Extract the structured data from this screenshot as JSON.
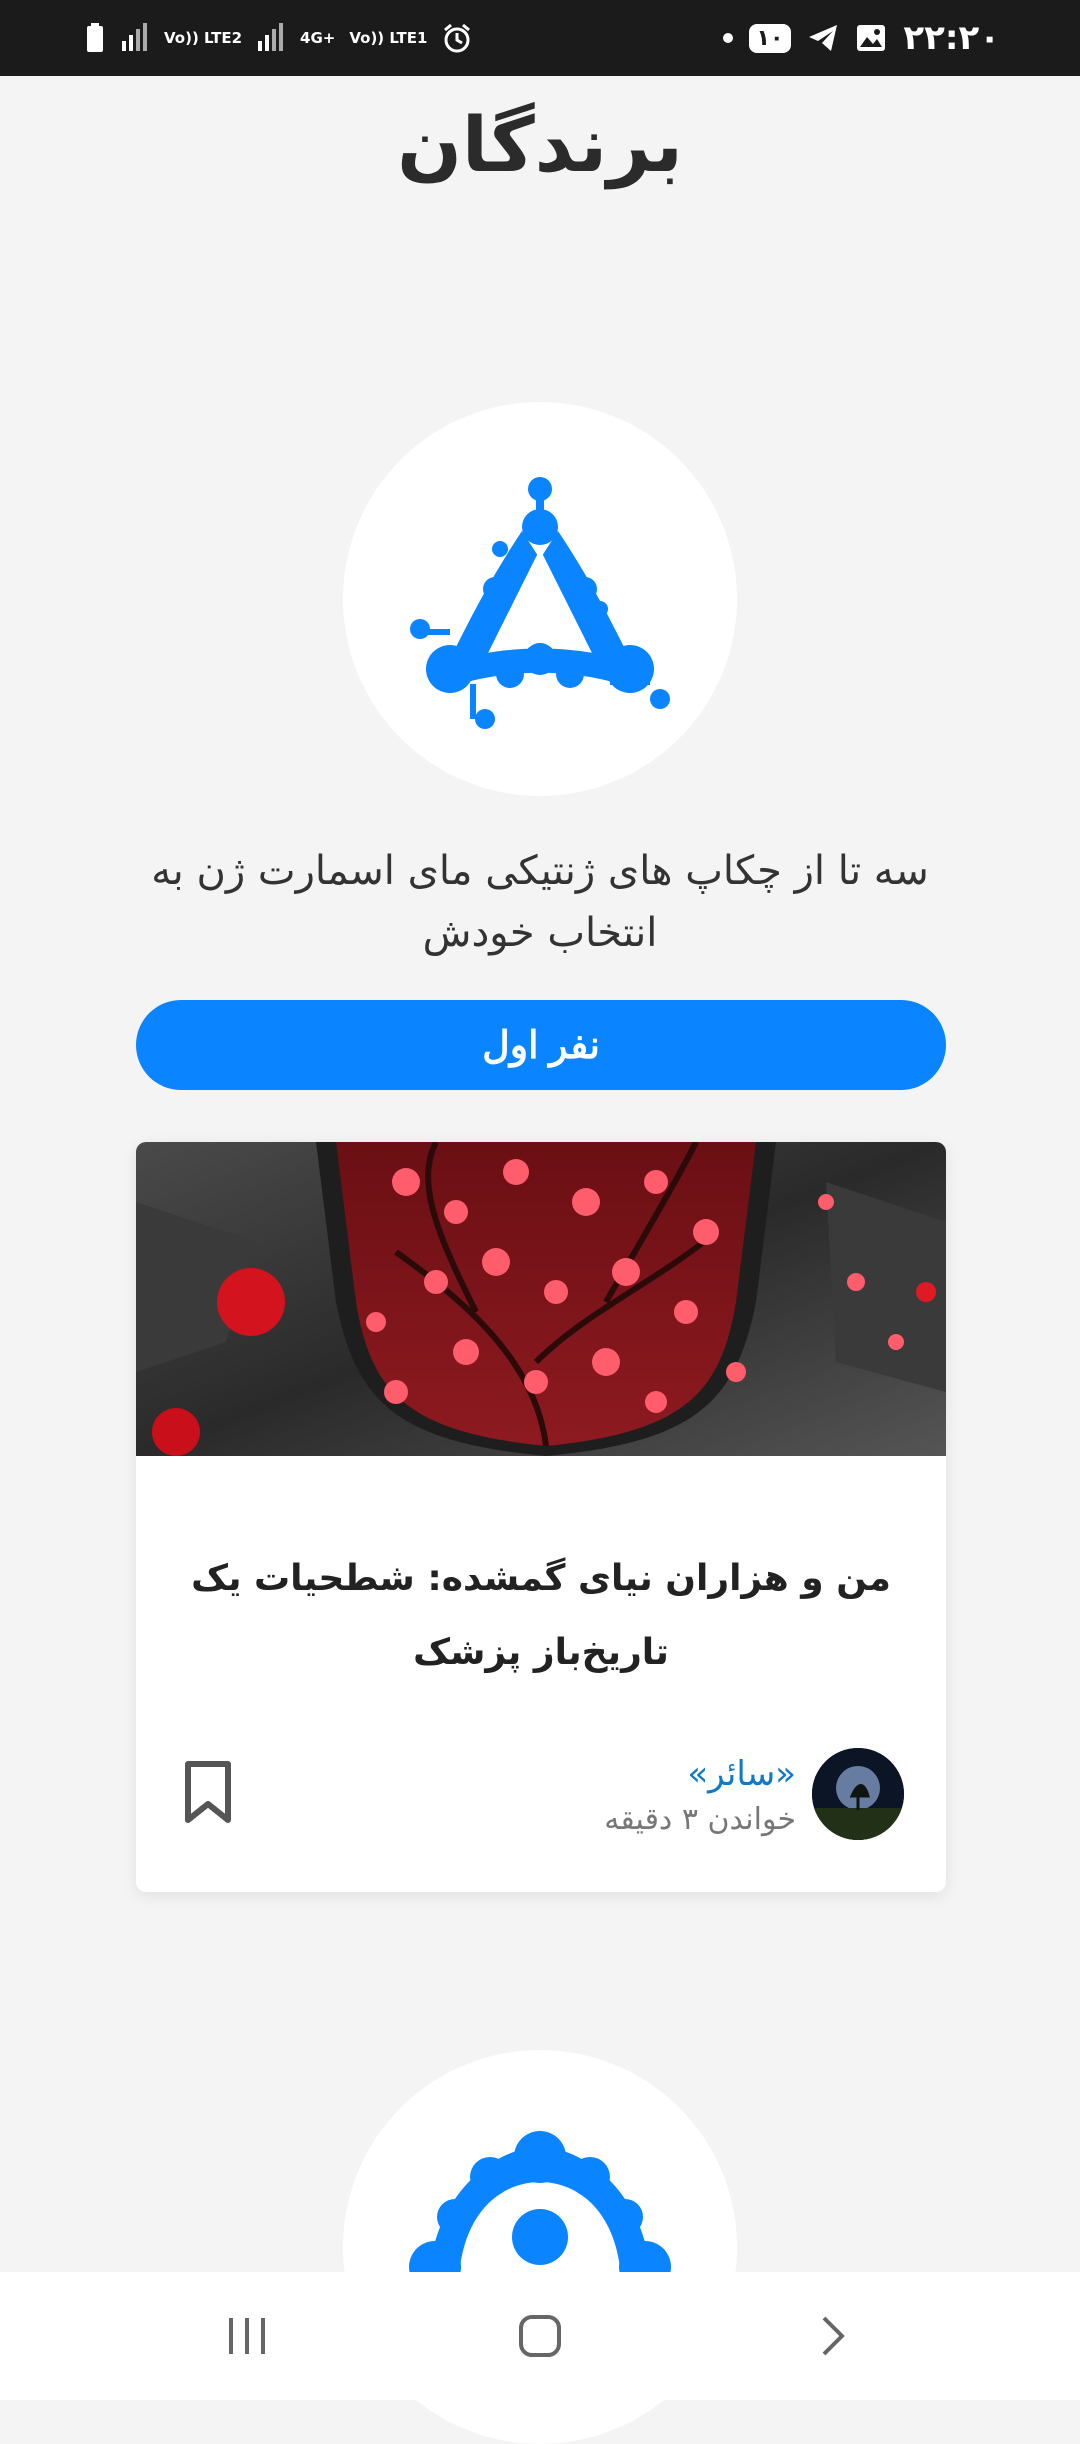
{
  "status_bar": {
    "time": "۲۲:۲۰",
    "notification_count": "۱۰",
    "network1": "Vo)) LTE2",
    "network2": "4G+",
    "network3": "Vo)) LTE1"
  },
  "page": {
    "title": "برندگان",
    "description": "سه تا از چکاپ های ژنتیکی مای اسمارت ژن به انتخاب خودش",
    "rank_button": "نفر اول"
  },
  "card": {
    "title": "من و هزاران نیای گمشده: شطحیات یک تاریخ‌باز پزشک",
    "author": "«سائر»",
    "read_time": "خواندن ۳ دقیقه"
  },
  "icons": {
    "logo": "dna-triangle-logo",
    "logo2": "dna-arc-logo",
    "bookmark": "bookmark-icon",
    "nav_recents": "recents-icon",
    "nav_home": "home-icon",
    "nav_back": "back-icon"
  },
  "colors": {
    "accent": "#0a84ff",
    "author_link": "#1279c6",
    "title": "#2b2b2b"
  }
}
